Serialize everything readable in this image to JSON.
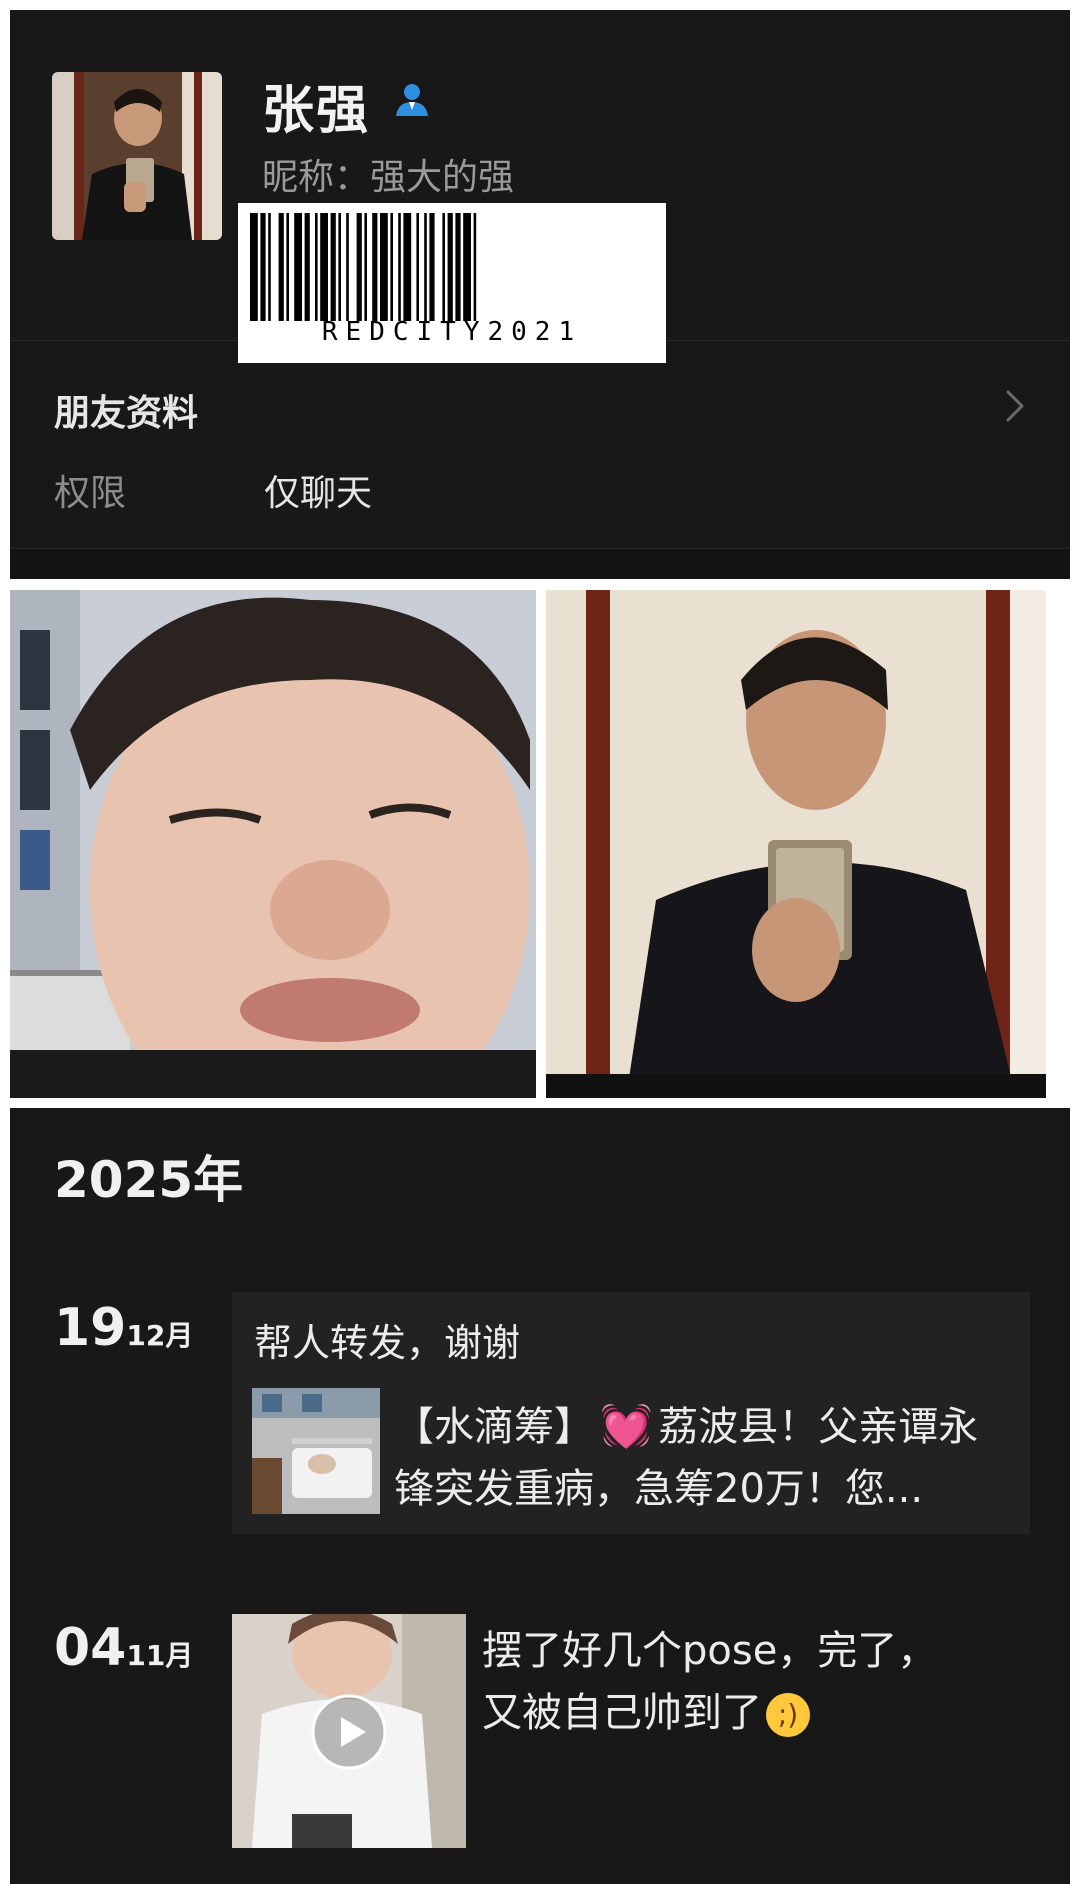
{
  "profile": {
    "name": "张强",
    "nickname": "昵称：强大的强",
    "contact_icon": "person-contact-icon"
  },
  "barcode": {
    "text": "REDCITY2021"
  },
  "friend_profile": {
    "label": "朋友资料",
    "chevron_icon": "chevron-right-icon"
  },
  "permissions": {
    "label": "权限",
    "value": "仅聊天"
  },
  "moments": {
    "year": "2025年",
    "posts": [
      {
        "day": "19",
        "month": "12月",
        "text": "帮人转发，谢谢",
        "link_line1_prefix": "【水滴筹】",
        "link_emoji": "💓",
        "link_line1_suffix": "荔波县！父亲谭永",
        "link_line2": "锋突发重病，急筹20万！您..."
      },
      {
        "day": "04",
        "month": "11月",
        "text_line1": "摆了好几个pose，完了，",
        "text_line2": "又被自己帅到了",
        "emoji": "😜",
        "media_icon": "play-icon"
      }
    ]
  },
  "colors": {
    "background": "#181818",
    "text_primary": "#ececec",
    "text_secondary": "#9a9a9a",
    "accent_blue": "#2e8fe0"
  }
}
